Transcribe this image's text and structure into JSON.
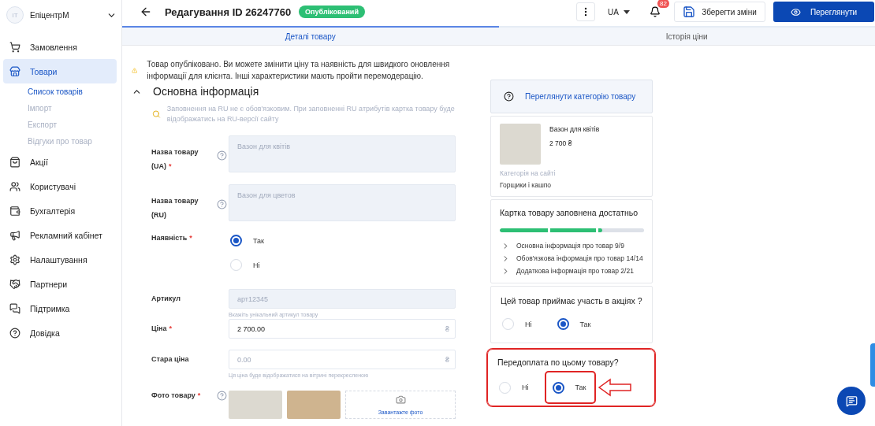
{
  "sidebar": {
    "account": {
      "initials": "IT",
      "name": "ЕпіцентрМ"
    },
    "items": [
      {
        "label": "Замовлення",
        "selected": false
      },
      {
        "label": "Товари",
        "selected": true,
        "children": [
          {
            "label": "Список товарів",
            "selected": true
          },
          {
            "label": "Імпорт",
            "selected": false
          },
          {
            "label": "Експорт",
            "selected": false
          },
          {
            "label": "Відгуки про товар",
            "selected": false
          }
        ]
      },
      {
        "label": "Акції",
        "selected": false
      },
      {
        "label": "Користувачі",
        "selected": false
      },
      {
        "label": "Бухгалтерія",
        "selected": false
      },
      {
        "label": "Рекламний кабінет",
        "selected": false
      },
      {
        "label": "Налаштування",
        "selected": false
      },
      {
        "label": "Партнери",
        "selected": false
      },
      {
        "label": "Підтримка",
        "selected": false
      },
      {
        "label": "Довідка",
        "selected": false
      }
    ]
  },
  "header": {
    "title": "Редагування ID 26247760",
    "status": "Опублікований",
    "language": "UA",
    "notifications": "82",
    "save_button": "Зберегти зміни",
    "preview_button": "Переглянути"
  },
  "tabs": [
    {
      "label": "Деталі товару",
      "selected": true
    },
    {
      "label": "Історія ціни",
      "selected": false
    }
  ],
  "notice": "Товар опубліковано. Ви можете змінити ціну та наявність для швидкого оновлення інформації для клієнта. Інші характеристики мають пройти перемодерацію.",
  "section": {
    "title": "Основна інформація",
    "expanded": true,
    "note": "Заповнення на RU не є обов'язковим. При заповненні RU атрибутів картка товару буде відображатись на RU-версії сайту"
  },
  "fields": [
    {
      "kind": "textarea",
      "label": "Назва товару (UA)",
      "required_mark": "*",
      "help": true,
      "value": "Вазон для квітів",
      "disabled": true
    },
    {
      "kind": "textarea",
      "label": "Назва товару (RU)",
      "help": true,
      "value": "Вазон для цветов",
      "disabled": true
    },
    {
      "kind": "radio",
      "label": "Наявність",
      "required_mark": "*",
      "options": [
        {
          "label": "Так",
          "selected": true
        },
        {
          "label": "Ні",
          "selected": false
        }
      ]
    },
    {
      "kind": "text",
      "label": "Артикул",
      "value": "арт12345",
      "disabled": true,
      "hint": "Вкажіть унікальний артикул товару"
    },
    {
      "kind": "money",
      "label": "Ціна",
      "required_mark": "*",
      "value": "2 700.00",
      "currency": "₴",
      "disabled": false
    },
    {
      "kind": "money",
      "label": "Стара ціна",
      "placeholder": "0.00",
      "currency": "₴",
      "disabled": false,
      "hint": "Ця ціна буде відображатися на вітрині перекресленою"
    },
    {
      "kind": "photos",
      "label": "Фото товару",
      "required_mark": "*",
      "help": true,
      "photos": [
        {
          "kind": "photo"
        },
        {
          "kind": "photo"
        }
      ],
      "upload": "Завантажте фото"
    }
  ],
  "side": {
    "category_button": "Переглянути категорію товару",
    "product": {
      "name": "Вазон для квітів",
      "price": "2 700 ₴",
      "category_label": "Категорія на сайті",
      "category": "Горщики і кашпо"
    },
    "completeness": {
      "title": "Картка товару заповнена достатньо",
      "level": 0.71,
      "items": [
        {
          "label": "Основна інформація про товар 9/9",
          "expanded": false
        },
        {
          "label": "Обов'язкова інформація про товар 14/14",
          "expanded": false
        },
        {
          "label": "Додаткова інформація про товар 2/21",
          "expanded": false
        }
      ]
    },
    "questions": [
      {
        "title": "Цей товар приймає участь в акціях ?",
        "highlighted": false,
        "options": [
          {
            "label": "Ні",
            "selected": false
          },
          {
            "label": "Так",
            "selected": true
          }
        ]
      },
      {
        "title": "Передоплата по цьому товару?",
        "highlighted": true,
        "options": [
          {
            "label": "Ні",
            "selected": false
          },
          {
            "label": "Так",
            "selected": true
          }
        ]
      }
    ]
  }
}
